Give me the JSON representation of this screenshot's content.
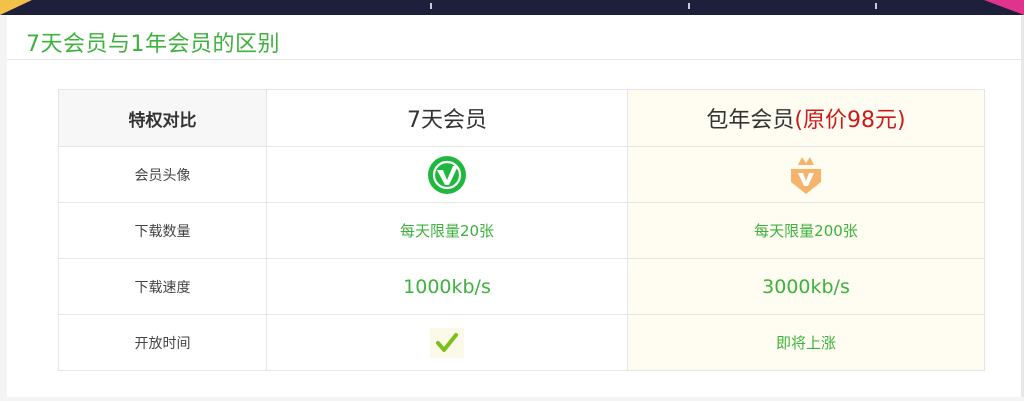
{
  "section_title": "7天会员与1年会员的区别",
  "table": {
    "header": {
      "label": "特权对比",
      "plan_7d": "7天会员",
      "plan_year": "包年会员",
      "plan_year_original_price": "(原价98元)"
    },
    "rows": [
      {
        "label": "会员头像",
        "plan_7d_icon": "green-v-badge-icon",
        "plan_year_icon": "orange-crown-v-badge-icon"
      },
      {
        "label": "下载数量",
        "plan_7d": "每天限量20张",
        "plan_year": "每天限量200张"
      },
      {
        "label": "下载速度",
        "plan_7d": "1000kb/s",
        "plan_year": "3000kb/s"
      },
      {
        "label": "开放时间",
        "plan_7d_icon": "check-icon",
        "plan_year": "即将上涨"
      }
    ]
  },
  "colors": {
    "accent_green": "#3db23d",
    "price_red": "#cc1a1a",
    "badge_orange": "#f5b36b",
    "check_green": "#7cc11a"
  }
}
